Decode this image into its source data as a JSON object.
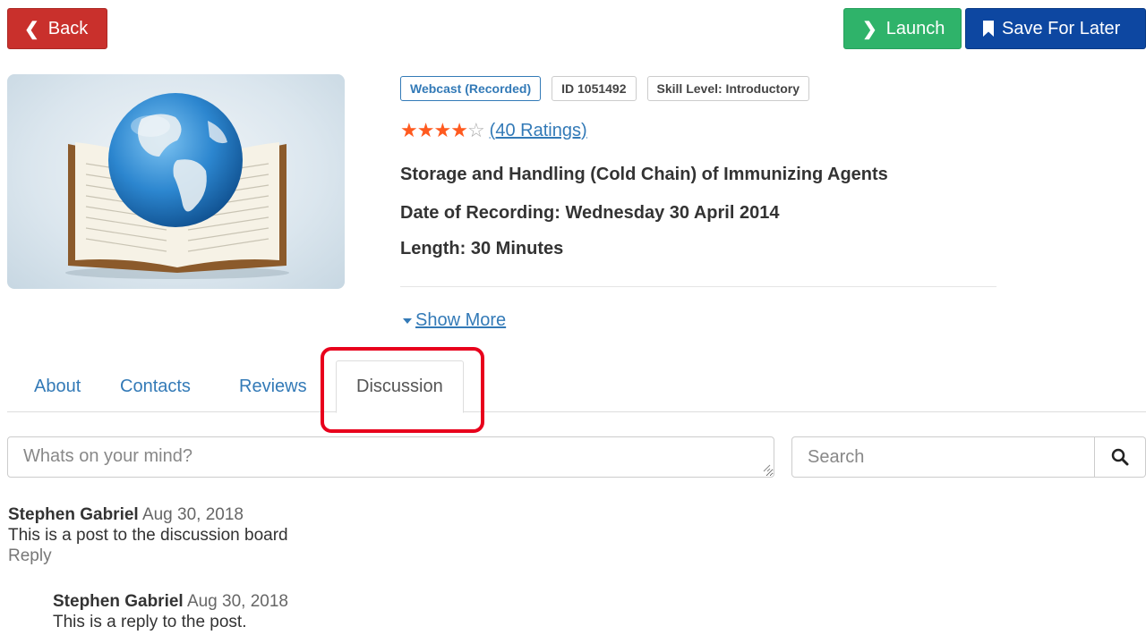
{
  "toolbar": {
    "back_label": "Back",
    "launch_label": "Launch",
    "save_label": "Save For Later"
  },
  "course": {
    "badges": [
      "Webcast (Recorded)",
      "ID 1051492",
      "Skill Level: Introductory"
    ],
    "rating": {
      "stars": 4,
      "max": 5,
      "label": "(40 Ratings)"
    },
    "title": "Storage and Handling (Cold Chain) of Immunizing Agents",
    "date": "Date of Recording: Wednesday 30 April 2014",
    "length": "Length: 30 Minutes",
    "show_more": "Show More"
  },
  "tabs": [
    {
      "label": "About"
    },
    {
      "label": "Contacts"
    },
    {
      "label": "Reviews"
    },
    {
      "label": "Discussion",
      "active": true
    }
  ],
  "discussion": {
    "post_placeholder": "Whats on your mind?",
    "search_placeholder": "Search",
    "posts": [
      {
        "author": "Stephen Gabriel",
        "date": "Aug 30, 2018",
        "text": "This is a post to the discussion board",
        "reply_label": "Reply"
      },
      {
        "author": "Stephen Gabriel",
        "date": "Aug 30, 2018",
        "text": "This is a reply to the post."
      }
    ]
  },
  "colors": {
    "back": "#c9302c",
    "launch": "#2fb36a",
    "save": "#0d47a1",
    "link": "#337ab7",
    "star": "#ff5a1f",
    "highlight": "#e8001c"
  },
  "icons": [
    "chevron-left-icon",
    "chevron-right-icon",
    "bookmark-icon",
    "globe-book-image",
    "caret-down-icon",
    "search-icon",
    "resize-grip-icon"
  ]
}
